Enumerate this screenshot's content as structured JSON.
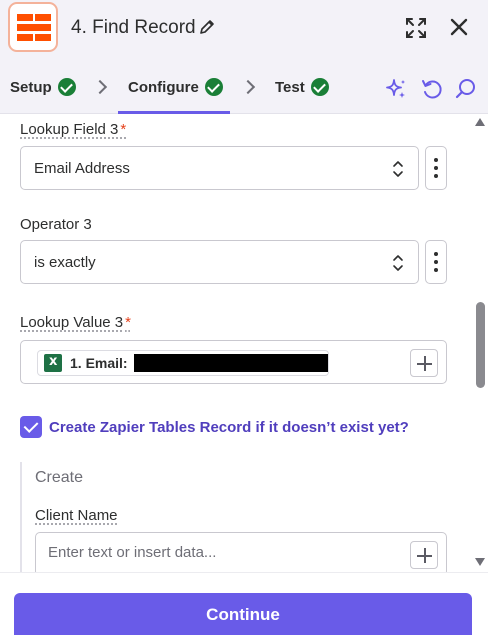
{
  "header": {
    "title": "4. Find Record"
  },
  "tabs": [
    {
      "label": "Setup",
      "complete": true
    },
    {
      "label": "Configure",
      "complete": true,
      "active": true
    },
    {
      "label": "Test",
      "complete": true
    }
  ],
  "form": {
    "lookup_field_3": {
      "label": "Lookup Field 3",
      "required": "*",
      "value": "Email Address"
    },
    "operator_3": {
      "label": "Operator 3",
      "value": "is exactly"
    },
    "lookup_value_3": {
      "label": "Lookup Value 3",
      "required": "*",
      "pill_text": "1. Email:"
    },
    "create_checkbox": {
      "label": "Create Zapier Tables Record if it doesn’t exist yet?",
      "checked": true
    },
    "create_section": {
      "heading": "Create",
      "client_name": {
        "label": "Client Name",
        "placeholder": "Enter text or insert data..."
      }
    }
  },
  "footer": {
    "continue_label": "Continue"
  },
  "colors": {
    "accent": "#695be8",
    "brand": "#ff4f00",
    "success": "#1a7f37",
    "checkbox_label": "#503ebd"
  },
  "icons": [
    "zapier-logo-icon",
    "pencil-icon",
    "expand-icon",
    "close-icon",
    "check-circle-icon",
    "chevron-right-icon",
    "sparkle-icon",
    "undo-icon",
    "search-icon",
    "up-down-icon",
    "kebab-icon",
    "excel-icon",
    "plus-icon"
  ]
}
